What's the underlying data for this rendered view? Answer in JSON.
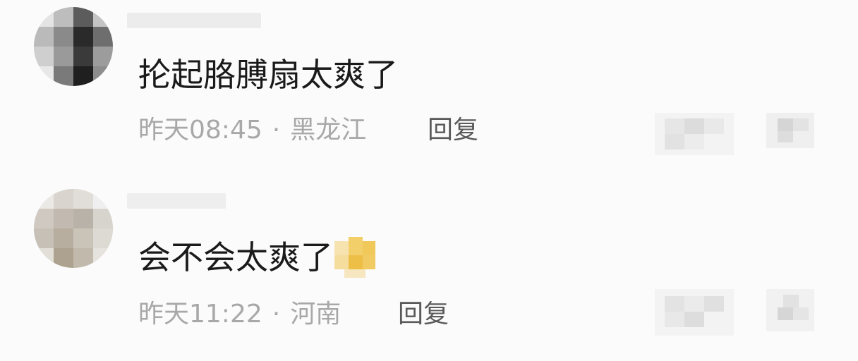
{
  "comments": [
    {
      "text": "抡起胳膊扇太爽了",
      "time": "昨天08:45",
      "separator": "·",
      "location": "黑龙江",
      "reply_label": "回复"
    },
    {
      "text": "会不会太爽了",
      "time": "昨天11:22",
      "separator": "·",
      "location": "河南",
      "reply_label": "回复"
    }
  ],
  "colors": {
    "content_text": "#1a1a1a",
    "meta_text": "#a8a8a8",
    "reply_text": "#5a5a5a",
    "background": "#fbfbfb"
  }
}
